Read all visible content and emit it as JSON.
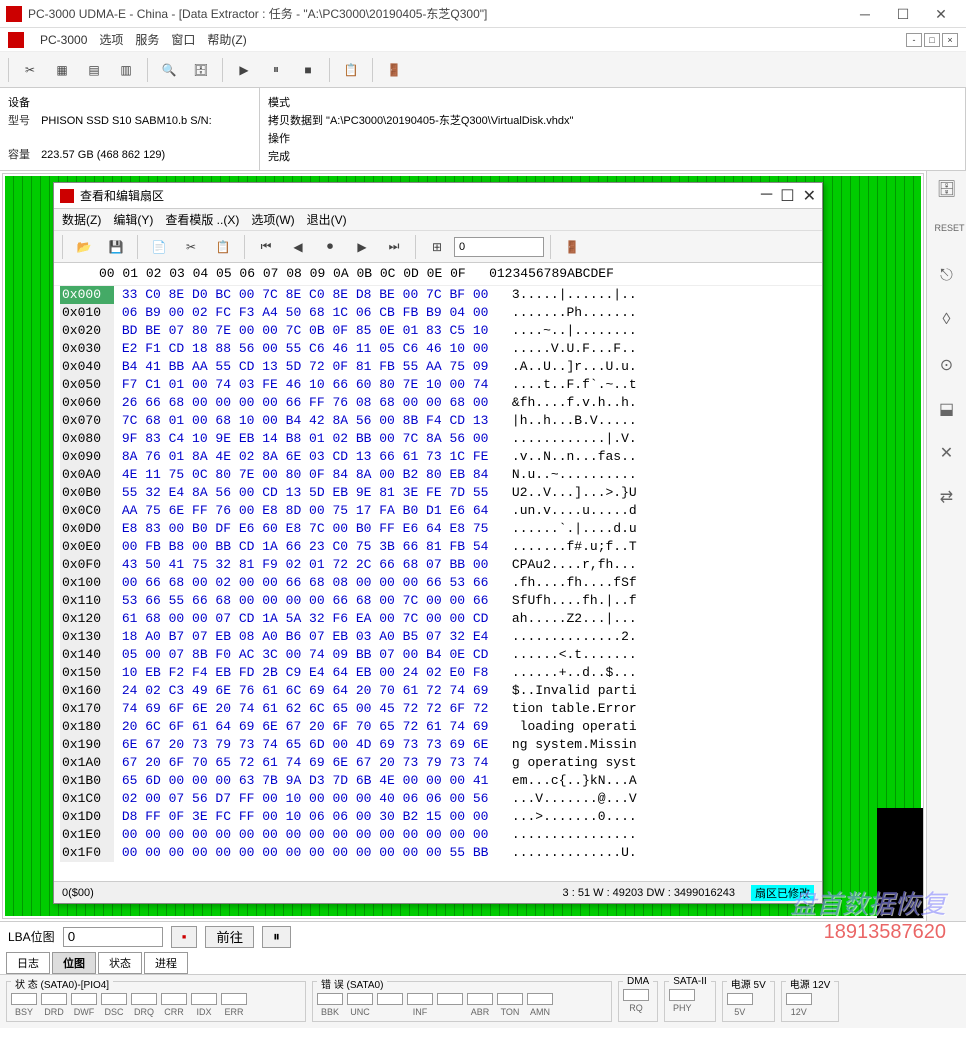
{
  "title": "PC-3000 UDMA-E - China - [Data Extractor : 任务 - \"A:\\PC3000\\20190405-东芝Q300\"]",
  "menubar": {
    "app": "PC-3000",
    "items": [
      "选项",
      "服务",
      "窗口",
      "帮助(Z)"
    ]
  },
  "info": {
    "left_header": "设备",
    "model_label": "型号",
    "model": "PHISON SSD S10 SABM10.b S/N:",
    "cap_label": "容量",
    "cap": "223.57 GB (468 862 129)",
    "right_header1": "模式",
    "right_val1": "拷贝数据到 \"A:\\PC3000\\20190405-东芝Q300\\VirtualDisk.vhdx\"",
    "right_header2": "操作",
    "right_val2": "完成"
  },
  "hex": {
    "title": "查看和编辑扇区",
    "menu": [
      "数据(Z)",
      "编辑(Y)",
      "查看模版 ..(X)",
      "选项(W)",
      "退出(V)"
    ],
    "search_value": "0",
    "header": "     00 01 02 03 04 05 06 07 08 09 0A 0B 0C 0D 0E 0F   0123456789ABCDEF",
    "rows": [
      {
        "o": "0x000",
        "h": "33 C0 8E D0 BC 00 7C 8E C0 8E D8 BE 00 7C BF 00",
        "a": "3.....|......|.."
      },
      {
        "o": "0x010",
        "h": "06 B9 00 02 FC F3 A4 50 68 1C 06 CB FB B9 04 00",
        "a": ".......Ph......."
      },
      {
        "o": "0x020",
        "h": "BD BE 07 80 7E 00 00 7C 0B 0F 85 0E 01 83 C5 10",
        "a": "....~..|........"
      },
      {
        "o": "0x030",
        "h": "E2 F1 CD 18 88 56 00 55 C6 46 11 05 C6 46 10 00",
        "a": ".....V.U.F...F.."
      },
      {
        "o": "0x040",
        "h": "B4 41 BB AA 55 CD 13 5D 72 0F 81 FB 55 AA 75 09",
        "a": ".A..U..]r...U.u."
      },
      {
        "o": "0x050",
        "h": "F7 C1 01 00 74 03 FE 46 10 66 60 80 7E 10 00 74",
        "a": "....t..F.f`.~..t"
      },
      {
        "o": "0x060",
        "h": "26 66 68 00 00 00 00 66 FF 76 08 68 00 00 68 00",
        "a": "&fh....f.v.h..h."
      },
      {
        "o": "0x070",
        "h": "7C 68 01 00 68 10 00 B4 42 8A 56 00 8B F4 CD 13",
        "a": "|h..h...B.V....."
      },
      {
        "o": "0x080",
        "h": "9F 83 C4 10 9E EB 14 B8 01 02 BB 00 7C 8A 56 00",
        "a": "............|.V."
      },
      {
        "o": "0x090",
        "h": "8A 76 01 8A 4E 02 8A 6E 03 CD 13 66 61 73 1C FE",
        "a": ".v..N..n...fas.."
      },
      {
        "o": "0x0A0",
        "h": "4E 11 75 0C 80 7E 00 80 0F 84 8A 00 B2 80 EB 84",
        "a": "N.u..~.........."
      },
      {
        "o": "0x0B0",
        "h": "55 32 E4 8A 56 00 CD 13 5D EB 9E 81 3E FE 7D 55",
        "a": "U2..V...]...>.}U"
      },
      {
        "o": "0x0C0",
        "h": "AA 75 6E FF 76 00 E8 8D 00 75 17 FA B0 D1 E6 64",
        "a": ".un.v....u.....d"
      },
      {
        "o": "0x0D0",
        "h": "E8 83 00 B0 DF E6 60 E8 7C 00 B0 FF E6 64 E8 75",
        "a": "......`.|....d.u"
      },
      {
        "o": "0x0E0",
        "h": "00 FB B8 00 BB CD 1A 66 23 C0 75 3B 66 81 FB 54",
        "a": ".......f#.u;f..T"
      },
      {
        "o": "0x0F0",
        "h": "43 50 41 75 32 81 F9 02 01 72 2C 66 68 07 BB 00",
        "a": "CPAu2....r,fh..."
      },
      {
        "o": "0x100",
        "h": "00 66 68 00 02 00 00 66 68 08 00 00 00 66 53 66",
        "a": ".fh....fh....fSf"
      },
      {
        "o": "0x110",
        "h": "53 66 55 66 68 00 00 00 00 66 68 00 7C 00 00 66",
        "a": "SfUfh....fh.|..f"
      },
      {
        "o": "0x120",
        "h": "61 68 00 00 07 CD 1A 5A 32 F6 EA 00 7C 00 00 CD",
        "a": "ah.....Z2...|..."
      },
      {
        "o": "0x130",
        "h": "18 A0 B7 07 EB 08 A0 B6 07 EB 03 A0 B5 07 32 E4",
        "a": "..............2."
      },
      {
        "o": "0x140",
        "h": "05 00 07 8B F0 AC 3C 00 74 09 BB 07 00 B4 0E CD",
        "a": "......<.t......."
      },
      {
        "o": "0x150",
        "h": "10 EB F2 F4 EB FD 2B C9 E4 64 EB 00 24 02 E0 F8",
        "a": "......+..d..$..."
      },
      {
        "o": "0x160",
        "h": "24 02 C3 49 6E 76 61 6C 69 64 20 70 61 72 74 69",
        "a": "$..Invalid parti"
      },
      {
        "o": "0x170",
        "h": "74 69 6F 6E 20 74 61 62 6C 65 00 45 72 72 6F 72",
        "a": "tion table.Error"
      },
      {
        "o": "0x180",
        "h": "20 6C 6F 61 64 69 6E 67 20 6F 70 65 72 61 74 69",
        "a": " loading operati"
      },
      {
        "o": "0x190",
        "h": "6E 67 20 73 79 73 74 65 6D 00 4D 69 73 73 69 6E",
        "a": "ng system.Missin"
      },
      {
        "o": "0x1A0",
        "h": "67 20 6F 70 65 72 61 74 69 6E 67 20 73 79 73 74",
        "a": "g operating syst"
      },
      {
        "o": "0x1B0",
        "h": "65 6D 00 00 00 63 7B 9A D3 7D 6B 4E 00 00 00 41",
        "a": "em...c{..}kN...A"
      },
      {
        "o": "0x1C0",
        "h": "02 00 07 56 D7 FF 00 10 00 00 00 40 06 06 00 56",
        "a": "...V.......@...V"
      },
      {
        "o": "0x1D0",
        "h": "D8 FF 0F 3E FC FF 00 10 06 06 00 30 B2 15 00 00",
        "a": "...>.......0...."
      },
      {
        "o": "0x1E0",
        "h": "00 00 00 00 00 00 00 00 00 00 00 00 00 00 00 00",
        "a": "................"
      },
      {
        "o": "0x1F0",
        "h": "00 00 00 00 00 00 00 00 00 00 00 00 00 00 55 BB",
        "a": "..............U."
      }
    ],
    "status_left": "0($00)",
    "status_mid": "3 : 51 W : 49203 DW : 3499016243",
    "status_right": "扇区已修改"
  },
  "lba": {
    "label": "LBA位图",
    "value": "0",
    "go": "前往"
  },
  "tabs": [
    "日志",
    "位图",
    "状态",
    "进程"
  ],
  "status_groups": {
    "sata": {
      "label": "状 态 (SATA0)-[PIO4]",
      "leds": [
        "BSY",
        "DRD",
        "DWF",
        "DSC",
        "DRQ",
        "CRR",
        "IDX",
        "ERR"
      ]
    },
    "err": {
      "label": "错 误 (SATA0)",
      "leds": [
        "BBK",
        "UNC",
        "",
        "INF",
        "",
        "ABR",
        "TON",
        "AMN"
      ]
    },
    "dma": {
      "label": "DMA",
      "leds": [
        "RQ"
      ]
    },
    "s2": {
      "label": "SATA-II",
      "leds": [
        "PHY"
      ]
    },
    "p5": {
      "label": "电源 5V",
      "leds": [
        "5V"
      ]
    },
    "p12": {
      "label": "电源 12V",
      "leds": [
        "12V"
      ]
    }
  },
  "watermark": {
    "text": "盘首数据恢复",
    "phone": "18913587620"
  }
}
